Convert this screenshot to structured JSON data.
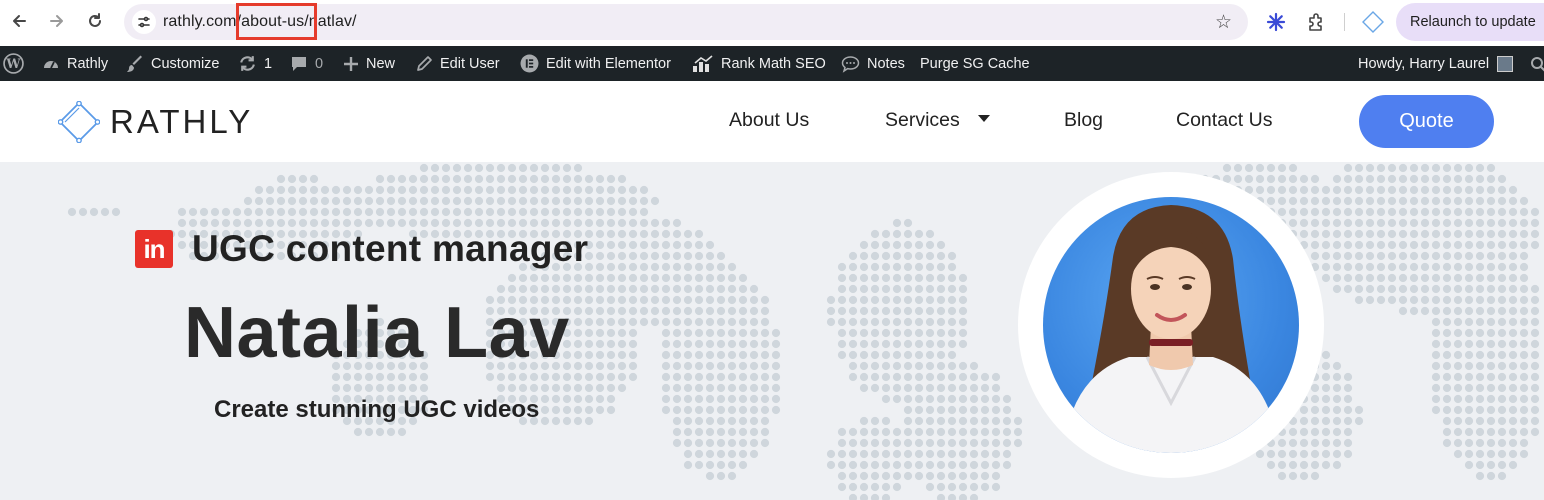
{
  "browser": {
    "url_text": "rathly.com/about-us/natlav/",
    "relaunch_label": "Relaunch to update",
    "accent_color": "#e8def8"
  },
  "admin_bar": {
    "site_name": "Rathly",
    "customize": "Customize",
    "updates_count": "1",
    "comments_count": "0",
    "new_label": "New",
    "edit_user": "Edit User",
    "elementor": "Edit with Elementor",
    "rank_math": "Rank Math SEO",
    "notes": "Notes",
    "purge_cache": "Purge SG Cache",
    "howdy": "Howdy, Harry Laurel"
  },
  "header": {
    "logo_text": "RATHLY",
    "menu": {
      "about": "About Us",
      "services": "Services",
      "blog": "Blog",
      "contact": "Contact Us"
    },
    "quote_label": "Quote",
    "brand_color": "#4f7ff0"
  },
  "hero": {
    "linkedin_badge": "in",
    "job_title": "UGC content manager",
    "name": "Natalia Lav",
    "tagline": "Create stunning UGC videos"
  }
}
